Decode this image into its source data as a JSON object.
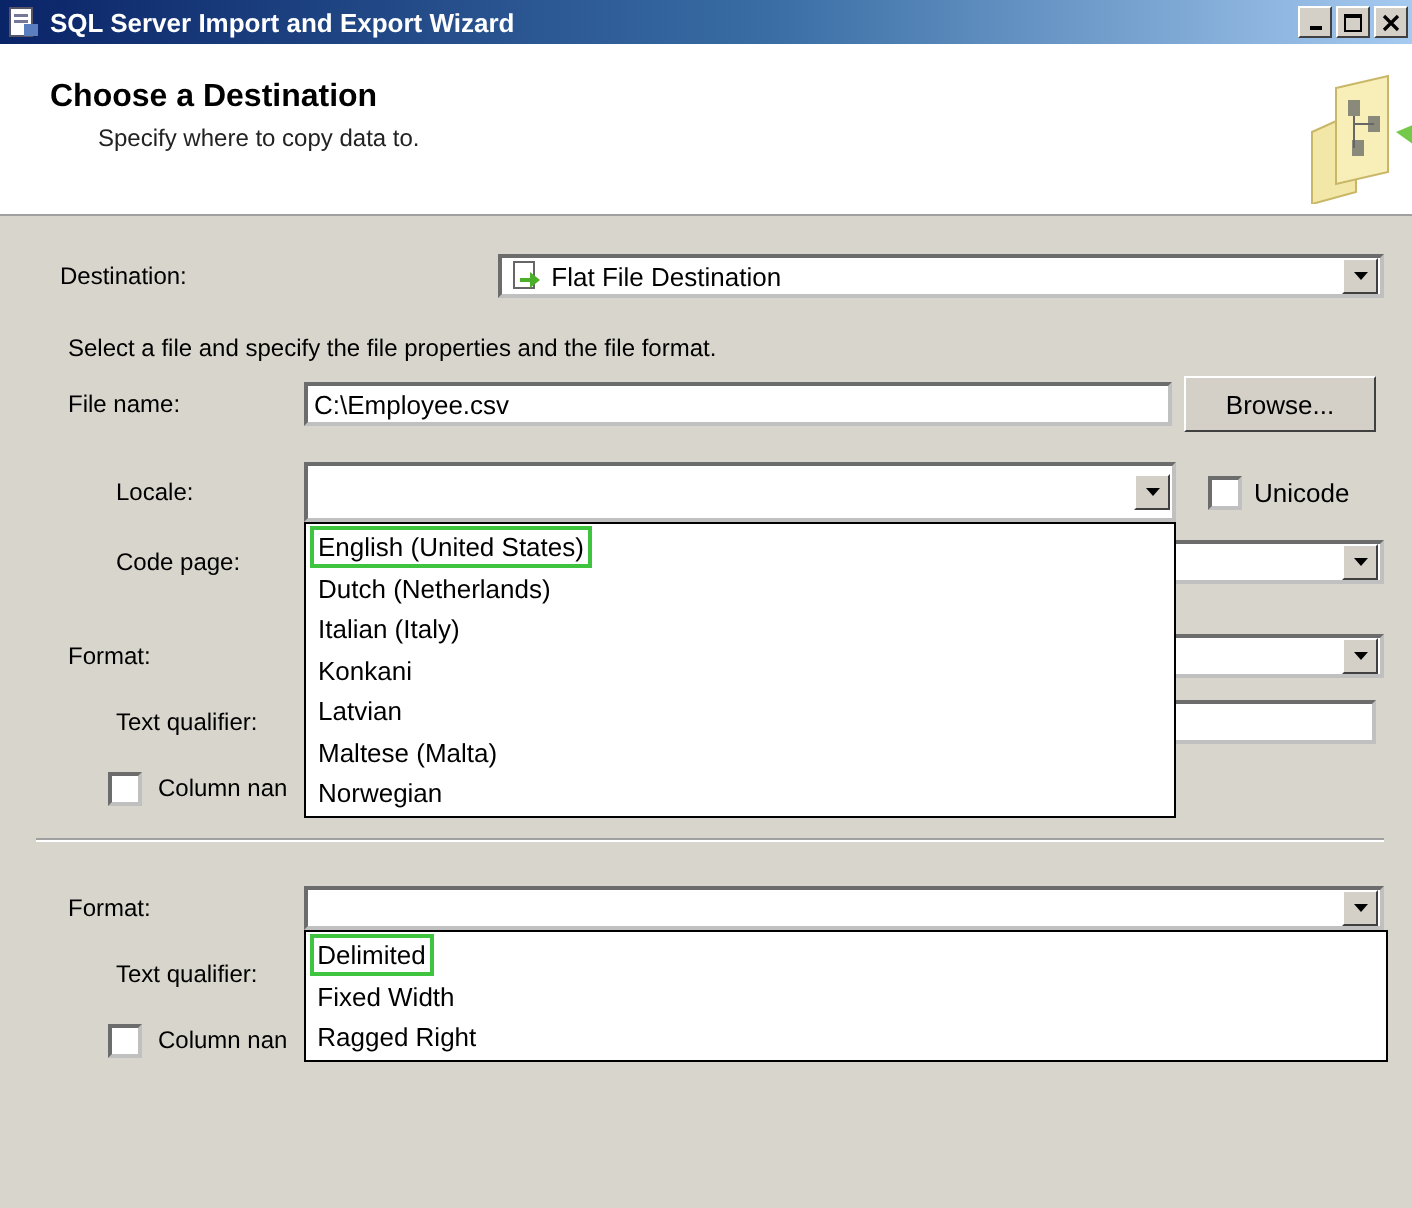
{
  "window": {
    "title": "SQL Server Import and Export Wizard"
  },
  "header": {
    "title": "Choose a Destination",
    "subtitle": "Specify where to copy data to."
  },
  "destination": {
    "label": "Destination:",
    "value": "Flat File Destination"
  },
  "instructions": "Select a file and specify the file properties and the file format.",
  "file_name": {
    "label": "File name:",
    "value": "C:\\Employee.csv",
    "button": "Browse..."
  },
  "locale": {
    "label": "Locale:",
    "expanded": true,
    "options": [
      {
        "label": "English (United States)",
        "highlighted": true
      },
      {
        "label": "Dutch (Netherlands)",
        "highlighted": false
      },
      {
        "label": "Italian (Italy)",
        "highlighted": false
      },
      {
        "label": "Konkani",
        "highlighted": false
      },
      {
        "label": "Latvian",
        "highlighted": false
      },
      {
        "label": "Maltese (Malta)",
        "highlighted": false
      },
      {
        "label": "Norwegian",
        "highlighted": false
      }
    ]
  },
  "unicode": {
    "label": "Unicode",
    "checked": false
  },
  "code_page": {
    "label": "Code page:"
  },
  "upper_format": {
    "label": "Format:",
    "text_qualifier": "Text qualifier:",
    "column_names": {
      "label": "Column nan",
      "checked": false
    }
  },
  "lower_format": {
    "label": "Format:",
    "expanded": true,
    "options": [
      {
        "label": "Delimited",
        "highlighted": true
      },
      {
        "label": "Fixed Width",
        "highlighted": false
      },
      {
        "label": "Ragged Right",
        "highlighted": false
      }
    ],
    "text_qualifier": "Text qualifier:",
    "column_names": {
      "label": "Column nan",
      "checked": false
    }
  }
}
